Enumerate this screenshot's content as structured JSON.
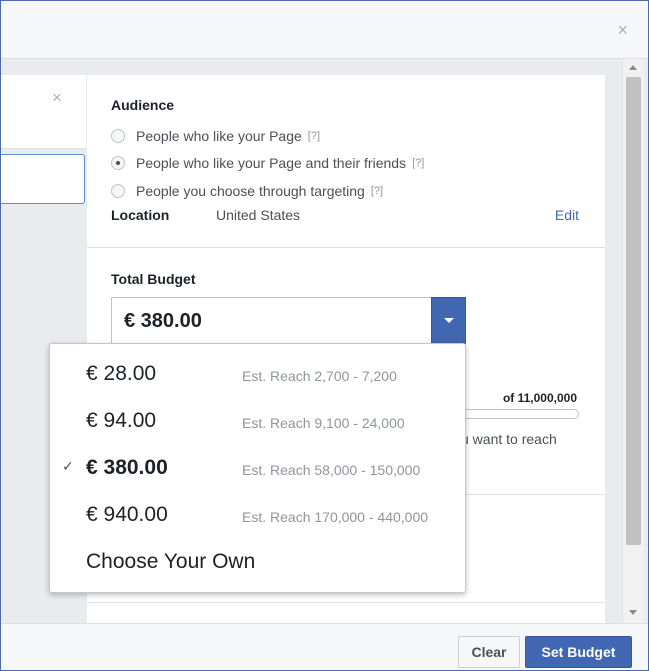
{
  "dialog": {
    "close_icon": "×"
  },
  "left_panel": {
    "close_icon": "×"
  },
  "audience": {
    "title": "Audience",
    "options": [
      {
        "label": "People who like your Page",
        "help": "[?]",
        "checked": false
      },
      {
        "label": "People who like your Page and their friends",
        "help": "[?]",
        "checked": true
      },
      {
        "label": "People you choose through targeting",
        "help": "[?]",
        "checked": false
      }
    ],
    "location_label": "Location",
    "location_value": "United States",
    "edit_label": "Edit"
  },
  "budget": {
    "title": "Total Budget",
    "selected_value": "€ 380.00",
    "reach_total": "of 11,000,000",
    "reach_text_partial": "u want to reach"
  },
  "dropdown": {
    "options": [
      {
        "price": "€ 28.00",
        "reach": "Est. Reach 2,700 - 7,200",
        "selected": false
      },
      {
        "price": "€ 94.00",
        "reach": "Est. Reach 9,100 - 24,000",
        "selected": false
      },
      {
        "price": "€ 380.00",
        "reach": "Est. Reach 58,000 - 150,000",
        "selected": true
      },
      {
        "price": "€ 940.00",
        "reach": "Est. Reach 170,000 - 440,000",
        "selected": false
      },
      {
        "price": "Choose Your Own",
        "reach": "",
        "selected": false
      }
    ],
    "check_mark": "✓"
  },
  "footer": {
    "clear_label": "Clear",
    "set_budget_label": "Set Budget"
  },
  "colors": {
    "accent": "#4267b2",
    "backdrop": "#3b5998"
  }
}
